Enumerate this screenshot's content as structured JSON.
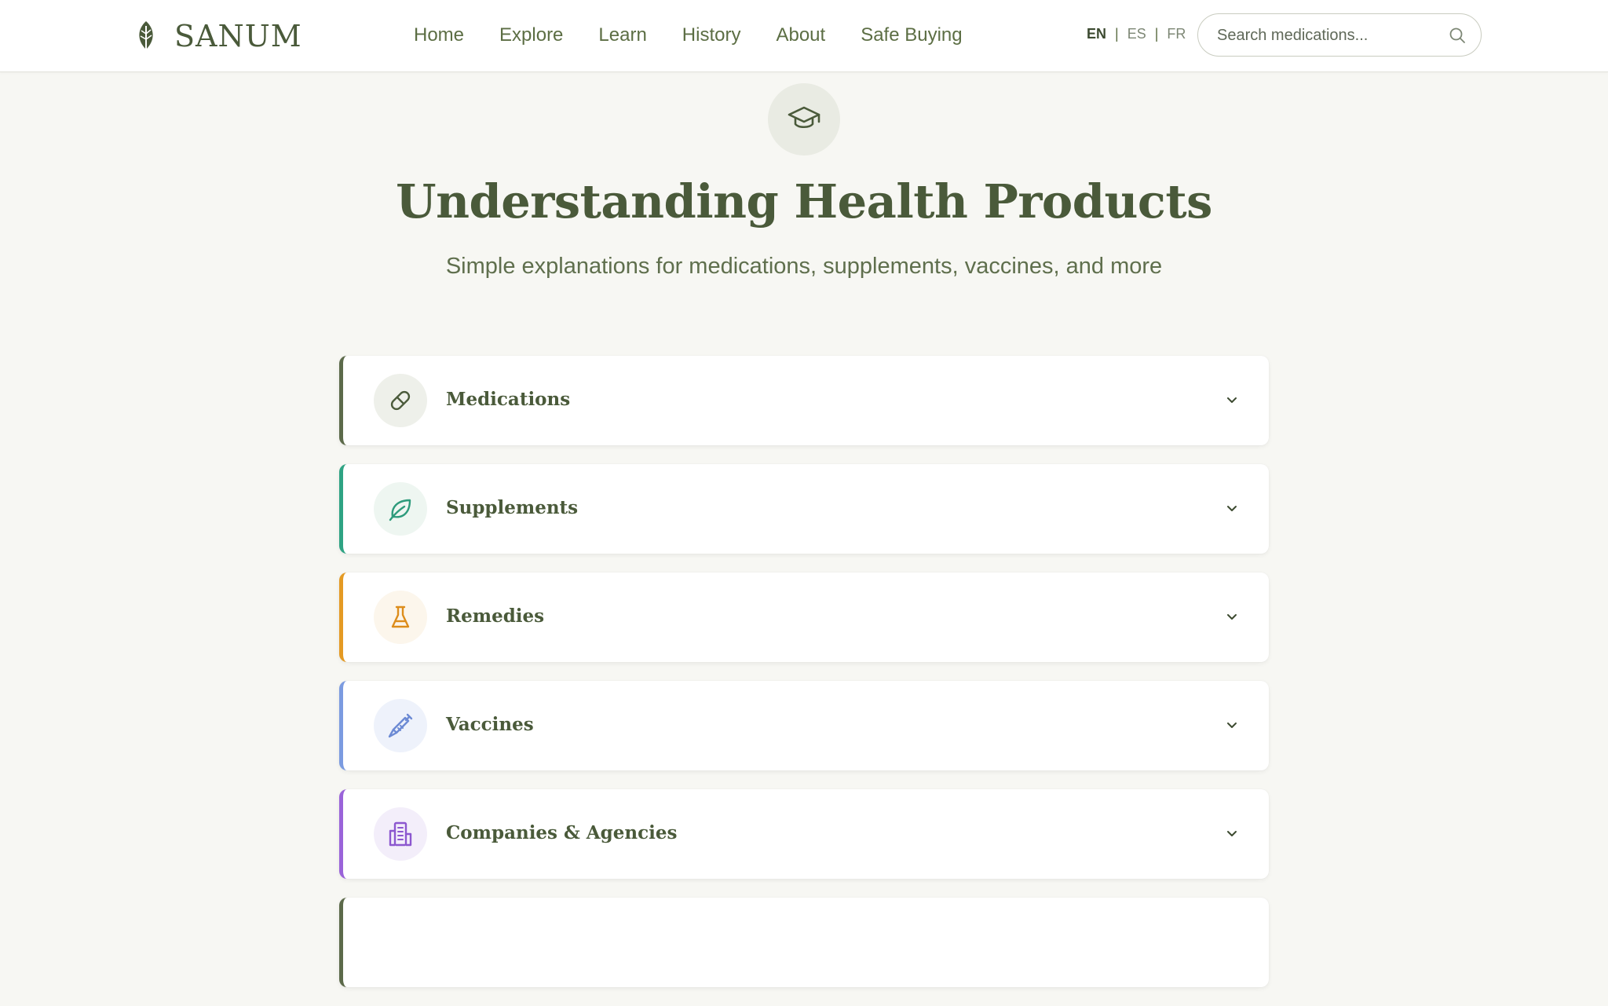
{
  "brand": {
    "name": "SANUM",
    "logo_icon": "leaf-icon"
  },
  "nav": {
    "items": [
      {
        "label": "Home"
      },
      {
        "label": "Explore"
      },
      {
        "label": "Learn"
      },
      {
        "label": "History"
      },
      {
        "label": "About"
      },
      {
        "label": "Safe Buying"
      }
    ]
  },
  "languages": {
    "options": [
      "EN",
      "ES",
      "FR"
    ],
    "separator": "|",
    "selected": "EN"
  },
  "search": {
    "placeholder": "Search medications...",
    "value": "",
    "icon": "search-icon"
  },
  "hero": {
    "icon": "graduation-cap-icon",
    "title": "Understanding Health Products",
    "subtitle": "Simple explanations for medications, supplements, vaccines, and more"
  },
  "categories": [
    {
      "label": "Medications",
      "icon": "pill-icon",
      "accent": "#5c6a4a",
      "icon_bg": "#eef0ea",
      "icon_color": "#4a5a3a"
    },
    {
      "label": "Supplements",
      "icon": "leaf-icon",
      "accent": "#2ea383",
      "icon_bg": "#eef6f1",
      "icon_color": "#2e9b7c"
    },
    {
      "label": "Remedies",
      "icon": "flask-icon",
      "accent": "#e49a23",
      "icon_bg": "#fcf6ec",
      "icon_color": "#dd8d1c"
    },
    {
      "label": "Vaccines",
      "icon": "syringe-icon",
      "accent": "#7b9be0",
      "icon_bg": "#eef2fb",
      "icon_color": "#6c8ad4"
    },
    {
      "label": "Companies & Agencies",
      "icon": "building-icon",
      "accent": "#9a63d9",
      "icon_bg": "#f3eefa",
      "icon_color": "#8c57cf"
    }
  ],
  "colors": {
    "brand_green": "#4a5a3a",
    "page_bg": "#f7f7f3"
  }
}
